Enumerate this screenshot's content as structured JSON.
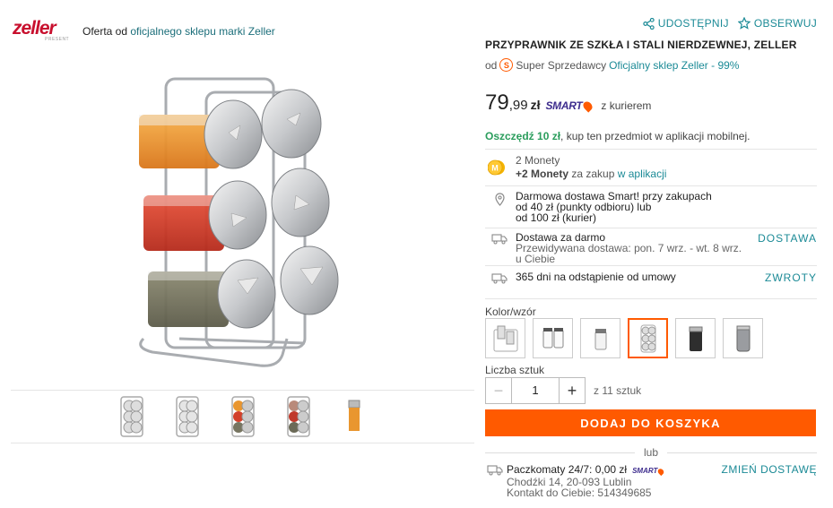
{
  "brand": {
    "logo_text": "zeller",
    "logo_sub": "PRESENT",
    "offer_prefix": "Oferta od ",
    "offer_link": "oficjalnego sklepu marki Zeller"
  },
  "gallery": {
    "thumbnails": [
      "thumb-1",
      "thumb-2",
      "thumb-3",
      "thumb-4",
      "thumb-5"
    ]
  },
  "actions": {
    "share": "UDOSTĘPNIJ",
    "watch": "OBSERWUJ"
  },
  "product": {
    "title": "PRZYPRAWNIK ZE SZKŁA I STALI NIERDZEWNEJ, ZELLER",
    "seller_prefix": "od",
    "seller_badge": "S",
    "seller_type": "Super Sprzedawcy",
    "seller_link": "Oficjalny sklep Zeller - 99%"
  },
  "price": {
    "main": "79",
    "cents": ",99",
    "currency": "zł",
    "smart": "SMART",
    "delivery": "z kurierem"
  },
  "save": {
    "bold": "Oszczędź 10 zł",
    "rest": ", kup ten przedmiot w aplikacji mobilnej."
  },
  "coins": {
    "line1": "2 Monety",
    "line2_bold": "+2 Monety",
    "line2_mid": " za zakup ",
    "line2_link": "w aplikacji"
  },
  "delivery_info": {
    "free_line1": "Darmowa dostawa Smart! przy zakupach",
    "free_line2": "od 40 zł (punkty odbioru) lub",
    "free_line3": "od 100 zł (kurier)",
    "ship_title": "Dostawa za darmo",
    "ship_sub1": "Przewidywana dostawa: pon. 7 wrz. - wt. 8 wrz.",
    "ship_sub2": "u Ciebie",
    "ship_link": "DOSTAWA",
    "return_text": "365 dni na odstąpienie od umowy",
    "return_link": "ZWROTY"
  },
  "variants": {
    "label": "Kolor/wzór",
    "selected_index": 3,
    "options": [
      "variant-1",
      "variant-2",
      "variant-3",
      "variant-4",
      "variant-5",
      "variant-6"
    ]
  },
  "quantity": {
    "label": "Liczba sztuk",
    "value": "1",
    "minus": "−",
    "plus": "+",
    "of_text": "z 11 sztuk"
  },
  "cart": {
    "add_label": "DODAJ DO KOSZYKA",
    "or_label": "lub"
  },
  "pickup": {
    "line1": "Paczkomaty 24/7: 0,00 zł",
    "smart": "SMART",
    "line2": "Chodźki 14, 20-093 Lublin",
    "line3": "Kontakt do Ciebie: 514349685",
    "change_link": "ZMIEŃ DOSTAWĘ"
  },
  "colors": {
    "accent": "#ff5a00",
    "link": "#1b8a96",
    "brand_red": "#c8102e",
    "save_green": "#2a9d5c",
    "smart_purple": "#3d2c8d"
  }
}
